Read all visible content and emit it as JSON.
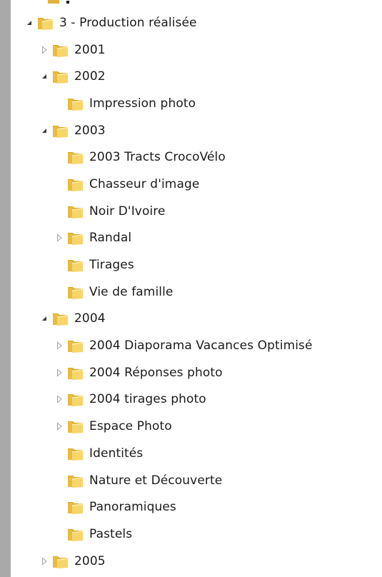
{
  "tree": {
    "items": [
      {
        "label": "3 - Production réalisée",
        "level": 0,
        "state": "expanded"
      },
      {
        "label": "2001",
        "level": 1,
        "state": "collapsed"
      },
      {
        "label": "2002",
        "level": 1,
        "state": "expanded"
      },
      {
        "label": "Impression photo",
        "level": 2,
        "state": "leaf"
      },
      {
        "label": "2003",
        "level": 1,
        "state": "expanded"
      },
      {
        "label": "2003 Tracts CrocoVélo",
        "level": 2,
        "state": "leaf"
      },
      {
        "label": "Chasseur d'image",
        "level": 2,
        "state": "leaf"
      },
      {
        "label": "Noir D'Ivoire",
        "level": 2,
        "state": "leaf"
      },
      {
        "label": "Randal",
        "level": 2,
        "state": "collapsed"
      },
      {
        "label": "Tirages",
        "level": 2,
        "state": "leaf"
      },
      {
        "label": "Vie de famille",
        "level": 2,
        "state": "leaf"
      },
      {
        "label": "2004",
        "level": 1,
        "state": "expanded"
      },
      {
        "label": "2004 Diaporama Vacances Optimisé",
        "level": 2,
        "state": "collapsed"
      },
      {
        "label": "2004 Réponses photo",
        "level": 2,
        "state": "collapsed"
      },
      {
        "label": "2004 tirages photo",
        "level": 2,
        "state": "collapsed"
      },
      {
        "label": "Espace Photo",
        "level": 2,
        "state": "collapsed"
      },
      {
        "label": "Identités",
        "level": 2,
        "state": "leaf"
      },
      {
        "label": "Nature et Découverte",
        "level": 2,
        "state": "leaf"
      },
      {
        "label": "Panoramiques",
        "level": 2,
        "state": "leaf"
      },
      {
        "label": "Pastels",
        "level": 2,
        "state": "leaf"
      },
      {
        "label": "2005",
        "level": 1,
        "state": "collapsed"
      }
    ],
    "icons": {
      "expanded": "expanded-triangle-icon",
      "collapsed": "collapsed-triangle-icon",
      "folder": "folder-icon"
    },
    "colors": {
      "folder_back": "#d9a520",
      "folder_front": "#f6d56b",
      "arrow_expanded": "#3c3c3c",
      "arrow_collapsed": "#a6a6a6",
      "text": "#1b1b1b",
      "outside": "#a9a9a9"
    }
  }
}
